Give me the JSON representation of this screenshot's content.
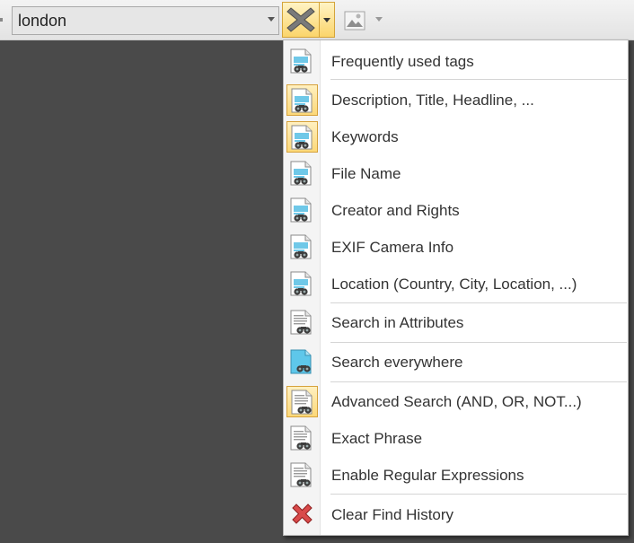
{
  "toolbar": {
    "search_value": "london",
    "clear_icon": "clear-x-icon",
    "image_icon": "image-icon"
  },
  "menu": {
    "items": [
      {
        "label": "Frequently used tags",
        "icon": "tag-search-icon",
        "checked": false
      },
      {
        "label": "Description, Title, Headline, ...",
        "icon": "tag-search-icon",
        "checked": true
      },
      {
        "label": "Keywords",
        "icon": "tag-search-icon",
        "checked": true
      },
      {
        "label": "File Name",
        "icon": "tag-search-icon",
        "checked": false
      },
      {
        "label": "Creator and Rights",
        "icon": "tag-search-icon",
        "checked": false
      },
      {
        "label": "EXIF Camera Info",
        "icon": "tag-search-icon",
        "checked": false
      },
      {
        "label": "Location (Country, City, Location, ...)",
        "icon": "tag-search-icon",
        "checked": false
      },
      {
        "label": "Search in Attributes",
        "icon": "document-search-icon",
        "checked": false
      },
      {
        "label": "Search everywhere",
        "icon": "blue-document-search-icon",
        "checked": false
      },
      {
        "label": "Advanced Search (AND, OR, NOT...)",
        "icon": "document-search-icon",
        "checked": true
      },
      {
        "label": "Exact Phrase",
        "icon": "document-search-icon",
        "checked": false
      },
      {
        "label": "Enable Regular Expressions",
        "icon": "document-search-icon",
        "checked": false
      },
      {
        "label": "Clear Find History",
        "icon": "red-x-icon",
        "checked": false
      }
    ]
  }
}
